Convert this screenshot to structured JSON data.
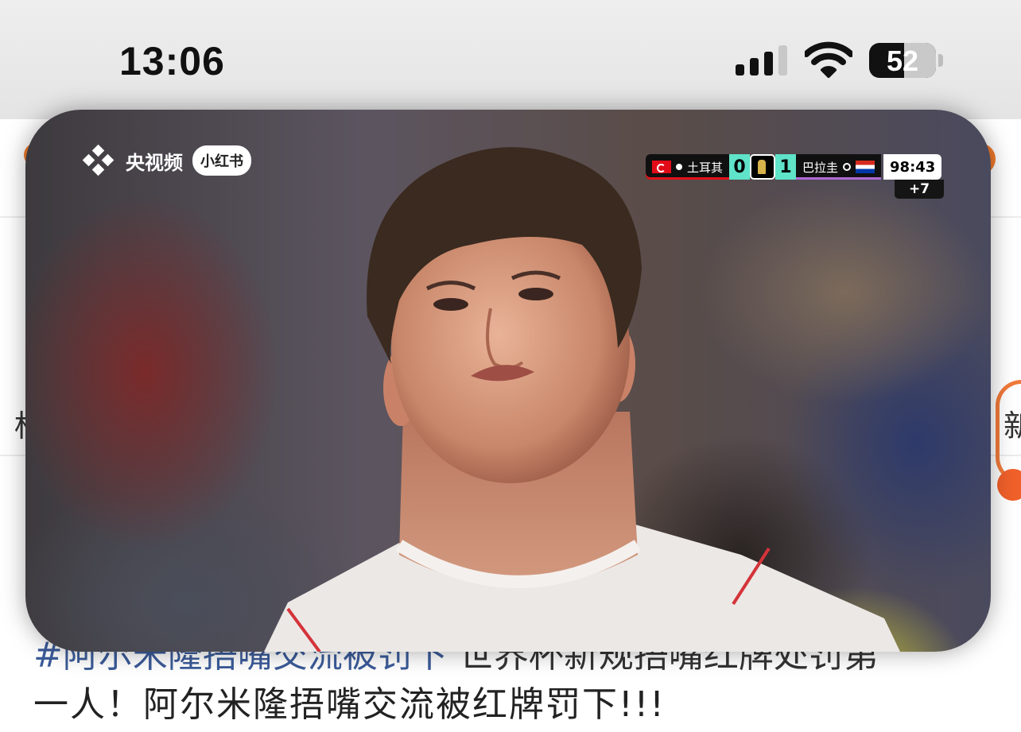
{
  "status_bar": {
    "time": "13:06",
    "battery_percent": "52",
    "signal_bars": 3,
    "icons": [
      "cellular-signal-icon",
      "wifi-icon",
      "battery-icon"
    ]
  },
  "background_page": {
    "hashtag_prefix": "#阿尔米隆捂嘴交流被罚下",
    "hashtag_rest": " 世界杯新规捂嘴红牌处罚第",
    "headline": "一人！阿尔米隆捂嘴交流被红牌罚下!!!",
    "left_edge_char": "标",
    "right_edge_char": "新"
  },
  "video": {
    "broadcaster": "央视频",
    "partner_badge": "小红书",
    "scoreboard": {
      "home_team": "土耳其",
      "home_score": "0",
      "away_score": "1",
      "away_team": "巴拉圭",
      "clock": "98:43",
      "added_time": "+7"
    }
  },
  "colors": {
    "accent_orange": "#f07a2a",
    "score_teal": "#5fe3c9",
    "hashtag_blue": "#3b5b99"
  }
}
